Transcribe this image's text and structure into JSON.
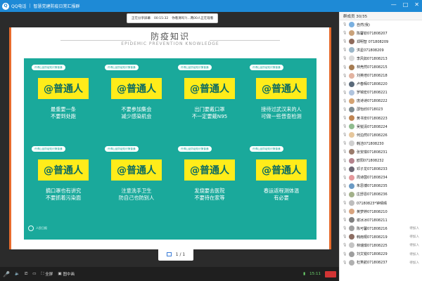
{
  "window": {
    "app_name": "QQ电话",
    "conference_title": "智慧党建防疫日常汇报群",
    "buttons": [
      "—",
      "□",
      "✕"
    ]
  },
  "share_bar": {
    "items": [
      "正在分享屏幕",
      "00:15:32",
      "你看清吗?(...两00人正在观看"
    ]
  },
  "slide": {
    "title_cn": "防疫知识",
    "title_en": "EPIDEMIC PREVENTION KNOWLEDGE",
    "tag_text": "许得山品防疫知识第普通",
    "label_text": "@普通人",
    "cards": [
      {
        "lines": [
          "最重要一条",
          "不要到处跑"
        ]
      },
      {
        "lines": [
          "不要参加集会",
          "减少感染机会"
        ]
      },
      {
        "lines": [
          "出门要戴口罩",
          "不一定要戴N95"
        ]
      },
      {
        "lines": [
          "接待过武汉来的人",
          "可做一些普查检测"
        ]
      },
      {
        "lines": [
          "摘口罩也有讲究",
          "不要抓着污染面"
        ]
      },
      {
        "lines": [
          "注意洗手卫生",
          "防自己也防别人"
        ]
      },
      {
        "lines": [
          "发烧要去医院",
          "不要待在家等"
        ]
      },
      {
        "lines": [
          "春运返程测体温",
          "有必要"
        ]
      }
    ],
    "footer_brand": "人民日报"
  },
  "page_indicator": "1 / 1",
  "bottom_bar": {
    "buttons": [
      "全屏",
      "图中画"
    ],
    "time": "15:11"
  },
  "members_panel": {
    "header": "群成员 30/35",
    "members": [
      {
        "name": "自然(我)",
        "status": "",
        "color": "#7ab0e0"
      },
      {
        "name": "陈馨钦071808207",
        "status": "",
        "color": "#c9a27a"
      },
      {
        "name": "郑明智 071808209",
        "status": "",
        "color": "#8e6a5b"
      },
      {
        "name": "洪星071808209",
        "status": "",
        "color": "#9bb7c9"
      },
      {
        "name": "李风如071808213",
        "status": "",
        "color": "#d9d9d9"
      },
      {
        "name": "林壳然071808215",
        "status": "",
        "color": "#a67c52"
      },
      {
        "name": "刘英培071808218",
        "status": "",
        "color": "#e2b3a0"
      },
      {
        "name": "卢春辉071808220",
        "status": "",
        "color": "#5a6a7a"
      },
      {
        "name": "罗锦宏071808221",
        "status": "",
        "color": "#b0c4de"
      },
      {
        "name": "庞诗诗071808222",
        "status": "",
        "color": "#d4a373"
      },
      {
        "name": "邵怡欣0718023",
        "status": "",
        "color": "#7d8b91"
      },
      {
        "name": "黄书安071808223",
        "status": "",
        "color": "#c08552"
      },
      {
        "name": "吴锐清071808224",
        "status": "",
        "color": "#8fbc8f"
      },
      {
        "name": "何泊然071808226",
        "status": "",
        "color": "#e6c79c"
      },
      {
        "name": "韩洁071808230",
        "status": "",
        "color": "#cfcfcf"
      },
      {
        "name": "张安琪071808231",
        "status": "",
        "color": "#9a7b6b"
      },
      {
        "name": "欧阳071808232",
        "status": "",
        "color": "#b5838d"
      },
      {
        "name": "邓子龙071808233",
        "status": "",
        "color": "#6d6875"
      },
      {
        "name": "周诗茵071808234",
        "status": "",
        "color": "#e5989b"
      },
      {
        "name": "朱思博071808235",
        "status": "",
        "color": "#6b9ac4"
      },
      {
        "name": "庄舒恩071808236",
        "status": "",
        "color": "#a3b18a"
      },
      {
        "name": "07180823*钟晴晴",
        "status": "",
        "color": "#bdbdbd"
      },
      {
        "name": "黄梦婷071808210",
        "status": "",
        "color": "#d8a47f"
      },
      {
        "name": "谢冰冰071808211",
        "status": "",
        "color": "#7f7f7f"
      },
      {
        "name": "陈可馨071808216",
        "status": "待加入",
        "color": "#a0a0a0"
      },
      {
        "name": "韩雨桐071808219",
        "status": "待加入",
        "color": "#8c6d62"
      },
      {
        "name": "林瑞琪071808225",
        "status": "待加入",
        "color": "#c4c4c4"
      },
      {
        "name": "刘文锐071808229",
        "status": "待加入",
        "color": "#9e9e9e"
      },
      {
        "name": "杜笑航071808237",
        "status": "待加入",
        "color": "#b0b0b0"
      }
    ]
  }
}
